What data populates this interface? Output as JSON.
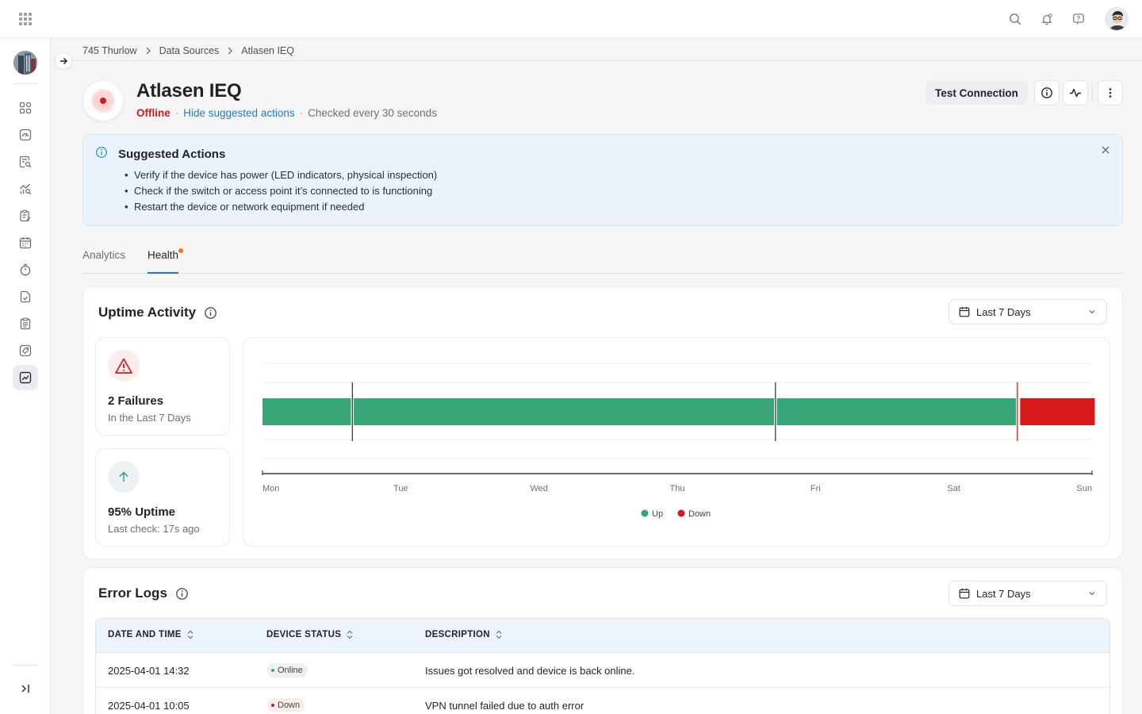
{
  "breadcrumb": [
    "745 Thurlow",
    "Data Sources",
    "Atlasen IEQ"
  ],
  "device": {
    "name": "Atlasen IEQ",
    "status": "Offline",
    "toggle_link": "Hide suggested actions",
    "check_interval": "Checked every 30 seconds",
    "test_button": "Test Connection"
  },
  "suggested": {
    "title": "Suggested Actions",
    "items": [
      "Verify if the device has power (LED indicators, physical inspection)",
      "Check if the switch or access point it’s connected to is functioning",
      "Restart the device or network equipment if needed"
    ]
  },
  "tabs": [
    {
      "label": "Analytics",
      "active": false
    },
    {
      "label": "Health",
      "active": true,
      "has_notification": true
    }
  ],
  "uptime": {
    "title": "Uptime Activity",
    "range": "Last 7 Days",
    "failures": {
      "value": "2 Failures",
      "sub": "In the Last 7 Days"
    },
    "uptime": {
      "value": "95% Uptime",
      "sub": "Last check: 17s ago"
    }
  },
  "chart_data": {
    "type": "timeline",
    "x_ticks": [
      "Mon",
      "Tue",
      "Wed",
      "Thu",
      "Fri",
      "Sat",
      "Sun"
    ],
    "segments": [
      {
        "start": 0.0,
        "end": 0.64,
        "state": "Up"
      },
      {
        "start": 0.66,
        "end": 3.7,
        "state": "Up"
      },
      {
        "start": 3.72,
        "end": 5.45,
        "state": "Up"
      },
      {
        "start": 5.48,
        "end": 6.02,
        "state": "Down"
      }
    ],
    "events": [
      0.65,
      3.71,
      5.46
    ],
    "legend": [
      {
        "name": "Up",
        "color": "#3aa77a"
      },
      {
        "name": "Down",
        "color": "#d61a1a"
      }
    ]
  },
  "errors": {
    "title": "Error Logs",
    "range": "Last 7 Days",
    "columns": [
      "DATE AND TIME",
      "DEVICE STATUS",
      "DESCRIPTION"
    ],
    "rows": [
      {
        "date": "2025-04-01 14:32",
        "status": "Online",
        "description": "Issues got resolved and device is back online."
      },
      {
        "date": "2025-04-01 10:05",
        "status": "Down",
        "description": "VPN tunnel failed due to auth error"
      }
    ]
  },
  "colors": {
    "accent": "#1f7ac7",
    "up": "#3aa77a",
    "down": "#d61a1a",
    "banner": "#eaf3fb"
  }
}
